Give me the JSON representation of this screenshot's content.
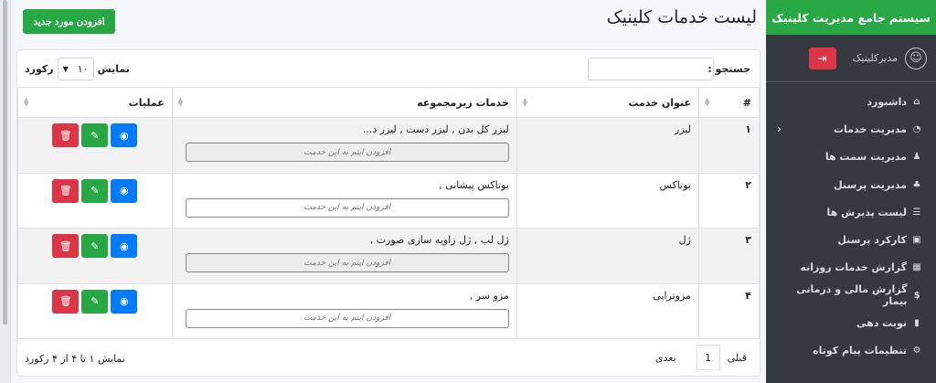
{
  "sidebar": {
    "brand": "سیستم جامع مدیریت کلینیک",
    "user_name": "مدیرکلینیک",
    "items": [
      {
        "label": "داشبورد",
        "icon": "⌂"
      },
      {
        "label": "مدیریت خدمات",
        "icon": "◔"
      },
      {
        "label": "مدیریت سمت ها",
        "icon": "♟"
      },
      {
        "label": "مدیریت پرسنل",
        "icon": "♣"
      },
      {
        "label": "لیست پذیرش ها",
        "icon": "☰"
      },
      {
        "label": "کارکرد پرسنل",
        "icon": "▣"
      },
      {
        "label": "گزارش خدمات روزانه",
        "icon": "▦"
      },
      {
        "label": "گزارش مالی و درمانی بیمار",
        "icon": "$"
      },
      {
        "label": "نوبت دهی",
        "icon": "▮"
      },
      {
        "label": "تنظیمات پیام کوتاه",
        "icon": "⚙"
      }
    ]
  },
  "header": {
    "title": "لیست خدمات کلینیک",
    "add_button": "افزودن مورد جدید"
  },
  "toolbar": {
    "search_label": "جستجو :",
    "search_value": "",
    "show_label": "نمایش",
    "show_value": "۱۰",
    "records_label": "رکورد"
  },
  "table": {
    "headers": {
      "num": "#",
      "title": "عنوان خدمت",
      "sub": "خدمات زیرمجموعه",
      "ops": "عملیات"
    },
    "add_item_label": "افزودن ایتم به این خدمت",
    "rows": [
      {
        "num": "۱",
        "title": "لیزر",
        "sub": "لیزر کل بدن , لیزر دست , لیزر د..."
      },
      {
        "num": "۲",
        "title": "بوتاکس",
        "sub": "بوتاکس پیشانی ,"
      },
      {
        "num": "۳",
        "title": "ژل",
        "sub": "ژل لب , ژل زاویه سازی صورت ,"
      },
      {
        "num": "۴",
        "title": "مزوتراپی",
        "sub": "مزو سر ,"
      }
    ]
  },
  "footer": {
    "info": "نمایش ۱ تا ۴ از ۴ رکورد",
    "prev": "قبلی",
    "page": "1",
    "next": "بعدی"
  }
}
